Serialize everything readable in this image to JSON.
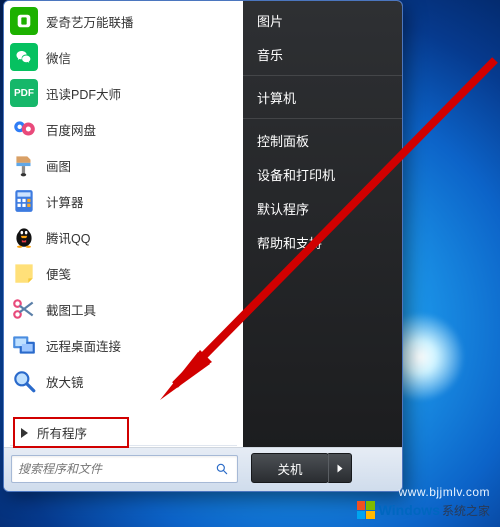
{
  "left_items": [
    {
      "label": "爱奇艺万能联播",
      "icon": "iqiyi",
      "bg": "#1db100"
    },
    {
      "label": "微信",
      "icon": "wechat",
      "bg": "#06c160"
    },
    {
      "label": "迅读PDF大师",
      "icon": "pdf",
      "bg": "#16b76a"
    },
    {
      "label": "百度网盘",
      "icon": "baidu",
      "bg": "#ffffff"
    },
    {
      "label": "画图",
      "icon": "paint",
      "bg": "#ffffff"
    },
    {
      "label": "计算器",
      "icon": "calc",
      "bg": "#ffffff"
    },
    {
      "label": "腾讯QQ",
      "icon": "qq",
      "bg": "#ffffff"
    },
    {
      "label": "便笺",
      "icon": "notes",
      "bg": "#ffffff"
    },
    {
      "label": "截图工具",
      "icon": "snip",
      "bg": "#ffffff"
    },
    {
      "label": "远程桌面连接",
      "icon": "rdp",
      "bg": "#ffffff"
    },
    {
      "label": "放大镜",
      "icon": "magnify",
      "bg": "#ffffff"
    }
  ],
  "right_items": [
    {
      "label": "图片"
    },
    {
      "label": "音乐"
    },
    {
      "label": "计算机"
    },
    {
      "label": "控制面板"
    },
    {
      "label": "设备和打印机"
    },
    {
      "label": "默认程序"
    },
    {
      "label": "帮助和支持"
    }
  ],
  "all_programs": "所有程序",
  "search_placeholder": "搜索程序和文件",
  "shutdown": "关机",
  "url": "www.bjjmlv.com",
  "watermark_brand": "Windows",
  "watermark_suffix": "系统之家",
  "annotation_color": "#d10000"
}
